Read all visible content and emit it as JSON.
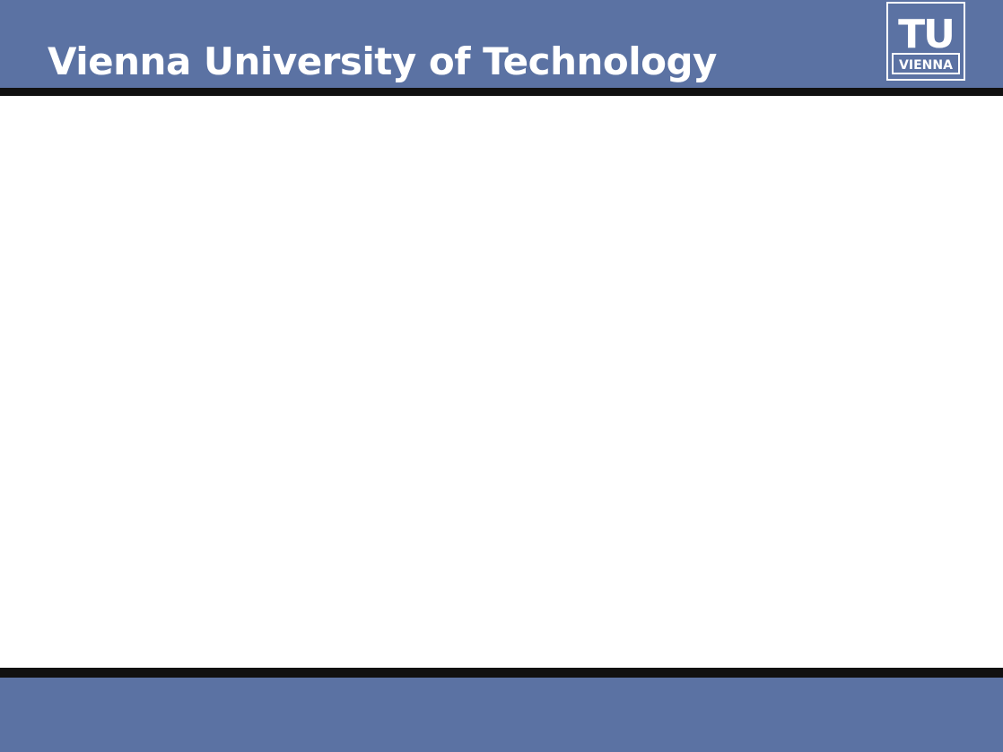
{
  "header": {
    "title": "Vienna University of Technology",
    "background_color": "#5b72a3"
  },
  "logo": {
    "text_top": "TU",
    "text_bottom": "VIENNA",
    "icon": "tu-vienna-logo"
  },
  "colors": {
    "band": "#5b72a3",
    "rule": "#111111",
    "background": "#ffffff"
  }
}
